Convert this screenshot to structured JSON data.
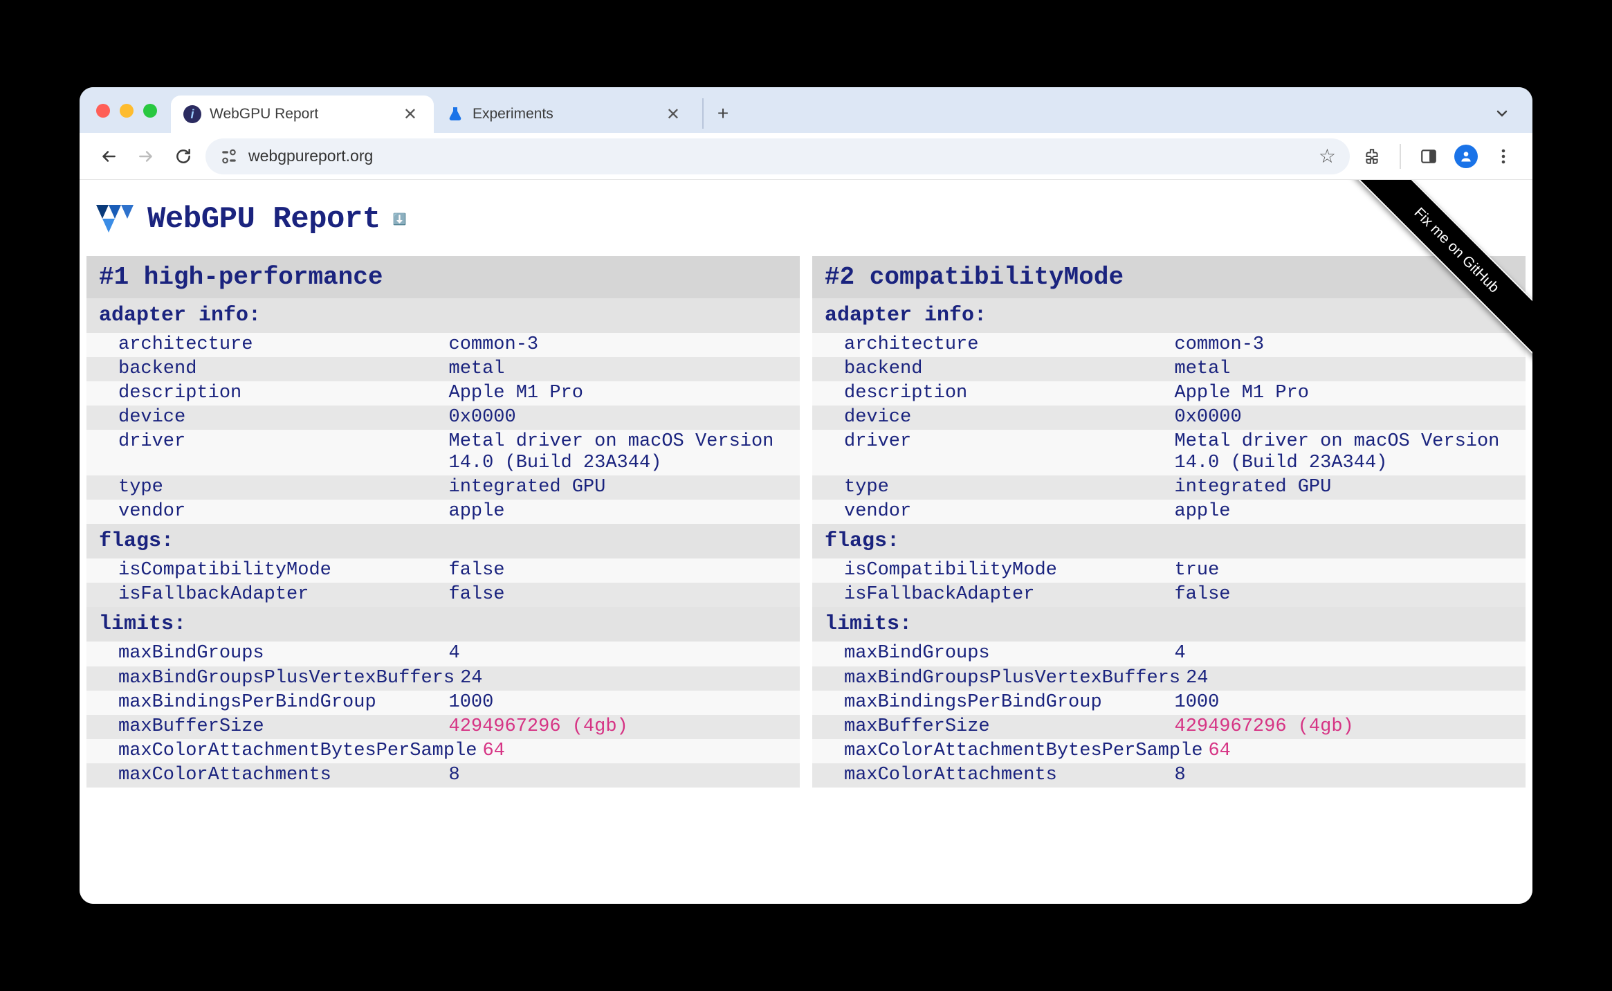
{
  "browser": {
    "tabs": [
      {
        "label": "WebGPU Report",
        "active": true,
        "favicon": "i",
        "favicon_bg": "#2b2b60"
      },
      {
        "label": "Experiments",
        "active": false,
        "favicon": "▲",
        "favicon_bg": "#1a73e8"
      }
    ],
    "url": "webgpureport.org"
  },
  "github_ribbon": "Fix me on GitHub",
  "page_title": "WebGPU Report",
  "panels": [
    {
      "title": "#1 high-performance",
      "sections": [
        {
          "header": "adapter info:",
          "rows": [
            {
              "k": "architecture",
              "v": "common-3"
            },
            {
              "k": "backend",
              "v": "metal"
            },
            {
              "k": "description",
              "v": "Apple M1 Pro"
            },
            {
              "k": "device",
              "v": "0x0000"
            },
            {
              "k": "driver",
              "v": "Metal driver on macOS Version 14.0 (Build 23A344)"
            },
            {
              "k": "type",
              "v": "integrated GPU"
            },
            {
              "k": "vendor",
              "v": "apple"
            }
          ]
        },
        {
          "header": "flags:",
          "rows": [
            {
              "k": "isCompatibilityMode",
              "v": "false"
            },
            {
              "k": "isFallbackAdapter",
              "v": "false"
            }
          ]
        },
        {
          "header": "limits:",
          "rows": [
            {
              "k": "maxBindGroups",
              "v": "4"
            },
            {
              "k": "maxBindGroupsPlusVertexBuffers",
              "v": "24"
            },
            {
              "k": "maxBindingsPerBindGroup",
              "v": "1000"
            },
            {
              "k": "maxBufferSize",
              "v": "4294967296 (4gb)",
              "pink": true
            },
            {
              "k": "maxColorAttachmentBytesPerSample",
              "v": "64",
              "pink": true
            },
            {
              "k": "maxColorAttachments",
              "v": "8"
            }
          ]
        }
      ]
    },
    {
      "title": "#2 compatibilityMode",
      "sections": [
        {
          "header": "adapter info:",
          "rows": [
            {
              "k": "architecture",
              "v": "common-3"
            },
            {
              "k": "backend",
              "v": "metal"
            },
            {
              "k": "description",
              "v": "Apple M1 Pro"
            },
            {
              "k": "device",
              "v": "0x0000"
            },
            {
              "k": "driver",
              "v": "Metal driver on macOS Version 14.0 (Build 23A344)"
            },
            {
              "k": "type",
              "v": "integrated GPU"
            },
            {
              "k": "vendor",
              "v": "apple"
            }
          ]
        },
        {
          "header": "flags:",
          "rows": [
            {
              "k": "isCompatibilityMode",
              "v": "true"
            },
            {
              "k": "isFallbackAdapter",
              "v": "false"
            }
          ]
        },
        {
          "header": "limits:",
          "rows": [
            {
              "k": "maxBindGroups",
              "v": "4"
            },
            {
              "k": "maxBindGroupsPlusVertexBuffers",
              "v": "24"
            },
            {
              "k": "maxBindingsPerBindGroup",
              "v": "1000"
            },
            {
              "k": "maxBufferSize",
              "v": "4294967296 (4gb)",
              "pink": true
            },
            {
              "k": "maxColorAttachmentBytesPerSample",
              "v": "64",
              "pink": true
            },
            {
              "k": "maxColorAttachments",
              "v": "8"
            }
          ]
        }
      ]
    }
  ]
}
